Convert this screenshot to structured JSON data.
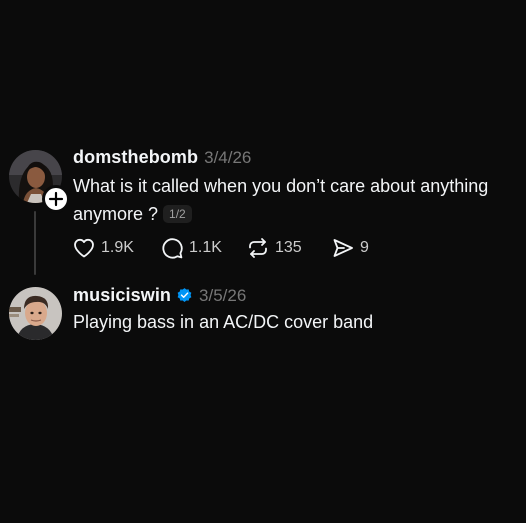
{
  "thread": {
    "posts": [
      {
        "username": "domsthebomb",
        "date": "3/4/26",
        "text": "What is it called when you don’t care about anything anymore ?",
        "page_indicator": "1/2",
        "has_follow_badge": true,
        "actions": {
          "likes": "1.9K",
          "replies": "1.1K",
          "reposts": "135",
          "shares": "9"
        }
      },
      {
        "username": "musiciswin",
        "verified": true,
        "date": "3/5/26",
        "text": "Playing bass in an AC/DC cover band"
      }
    ]
  },
  "colors": {
    "background": "#0b0b0b",
    "text_primary": "#f3f5f7",
    "text_secondary": "#777777",
    "verified_blue": "#0095f6",
    "thread_line": "#3a3a3a"
  },
  "icons": {
    "follow": "plus-icon",
    "verified": "verified-badge-icon",
    "like": "heart-icon",
    "reply": "comment-icon",
    "repost": "repost-icon",
    "share": "send-icon"
  }
}
